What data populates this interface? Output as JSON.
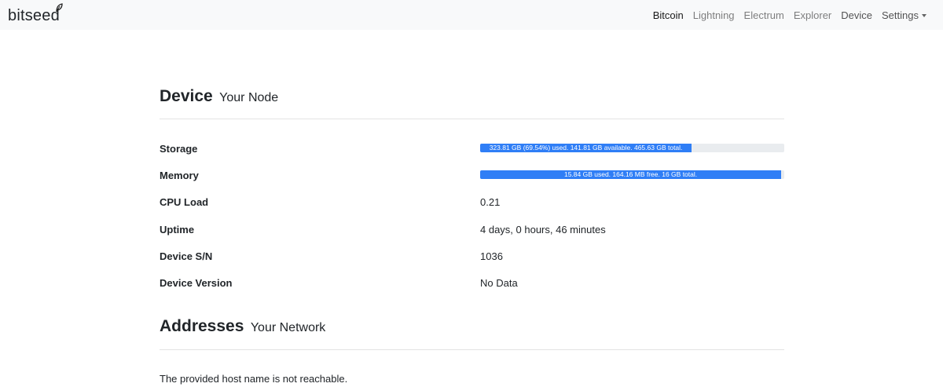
{
  "brand": {
    "name": "bitseed",
    "logo_icon": "leaf-icon"
  },
  "nav": {
    "items": [
      {
        "label": "Bitcoin",
        "state": "active"
      },
      {
        "label": "Lightning",
        "state": "muted"
      },
      {
        "label": "Electrum",
        "state": "muted"
      },
      {
        "label": "Explorer",
        "state": "muted"
      },
      {
        "label": "Device",
        "state": "normal"
      }
    ],
    "settings_label": "Settings",
    "settings_icon": "caret-down-icon"
  },
  "device_section": {
    "title": "Device",
    "subtitle": "Your Node"
  },
  "stats": {
    "storage": {
      "label": "Storage",
      "bar_text": "323.81 GB (69.54%) used. 141.81 GB available. 465.63 GB total.",
      "used_percent": 69.54
    },
    "memory": {
      "label": "Memory",
      "bar_text": "15.84 GB used. 164.16 MB free. 16 GB total.",
      "used_percent": 99
    },
    "cpu": {
      "label": "CPU Load",
      "value": "0.21"
    },
    "uptime": {
      "label": "Uptime",
      "value": "4 days, 0 hours, 46 minutes"
    },
    "serial": {
      "label": "Device S/N",
      "value": "1036"
    },
    "version": {
      "label": "Device Version",
      "value": "No Data"
    }
  },
  "addresses_section": {
    "title": "Addresses",
    "subtitle": "Your Network",
    "message": "The provided host name is not reachable."
  },
  "colors": {
    "navbar_bg": "#f8f9fa",
    "progress_bar": "#2f7ef6",
    "progress_track": "#e9ecef"
  }
}
